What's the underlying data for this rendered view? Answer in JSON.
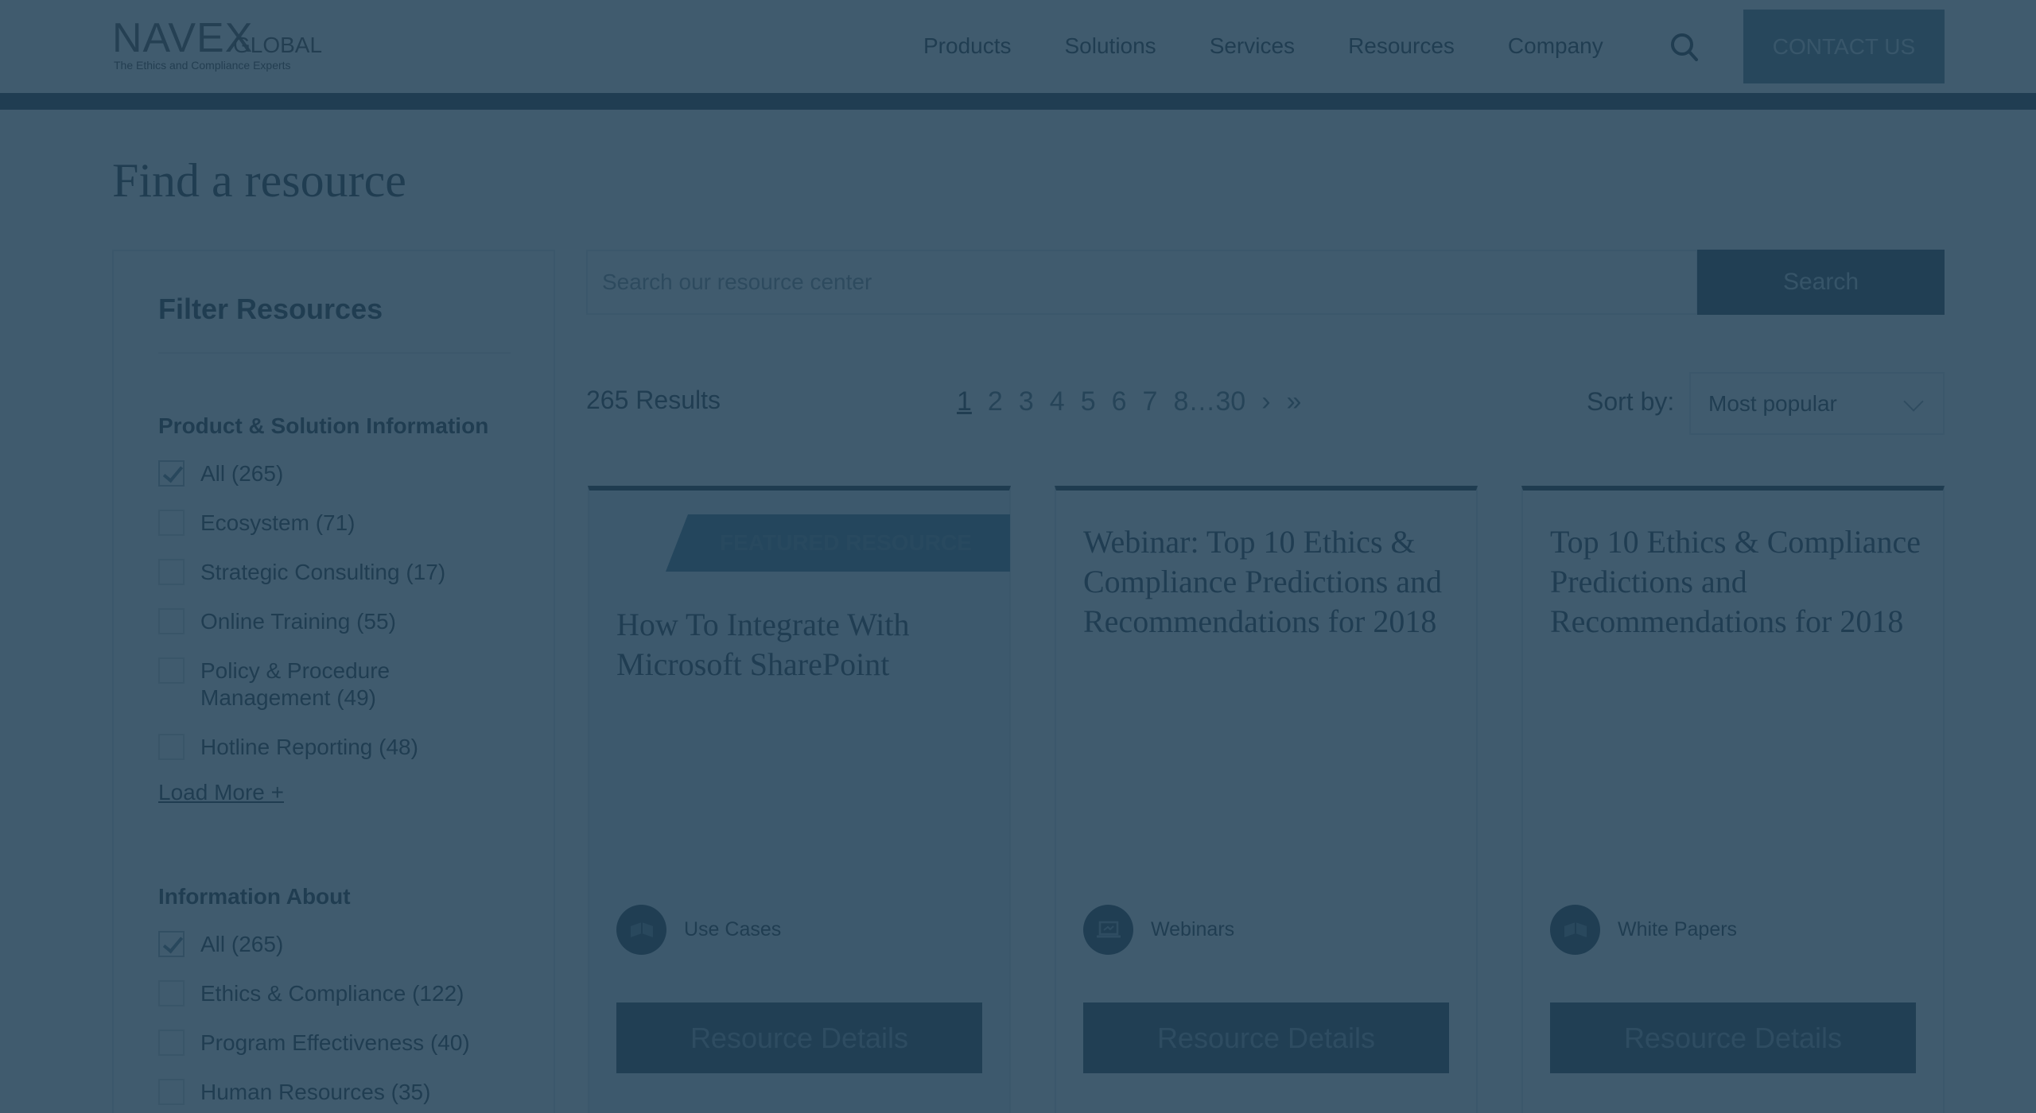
{
  "header": {
    "logo_main": "NAVEX",
    "logo_global": "GLOBAL",
    "logo_tagline": "The Ethics and Compliance Experts",
    "nav": [
      "Products",
      "Solutions",
      "Services",
      "Resources",
      "Company"
    ],
    "contact_label": "CONTACT US"
  },
  "page_title": "Find a resource",
  "filters": {
    "title": "Filter Resources",
    "groups": [
      {
        "title": "Product & Solution Information",
        "items": [
          {
            "label": "All (265)",
            "checked": true
          },
          {
            "label": "Ecosystem (71)",
            "checked": false
          },
          {
            "label": "Strategic Consulting (17)",
            "checked": false
          },
          {
            "label": "Online Training (55)",
            "checked": false
          },
          {
            "label": "Policy & Procedure Management (49)",
            "checked": false
          },
          {
            "label": "Hotline Reporting (48)",
            "checked": false
          }
        ],
        "load_more": "Load More +"
      },
      {
        "title": "Information About",
        "items": [
          {
            "label": "All (265)",
            "checked": true
          },
          {
            "label": "Ethics & Compliance (122)",
            "checked": false
          },
          {
            "label": "Program Effectiveness (40)",
            "checked": false
          },
          {
            "label": "Human Resources (35)",
            "checked": false
          }
        ]
      }
    ]
  },
  "search": {
    "placeholder": "Search our resource center",
    "button_label": "Search"
  },
  "results": {
    "count_label": "265 Results",
    "pages": [
      "1",
      "2",
      "3",
      "4",
      "5",
      "6",
      "7",
      "8…30",
      "›",
      "»"
    ],
    "current_page": "1",
    "sort_label": "Sort by:",
    "sort_value": "Most popular"
  },
  "cards": [
    {
      "featured_label": "FEATURED RESOURCE",
      "title": "How To Integrate With Microsoft SharePoint",
      "type": "Use Cases",
      "button": "Resource Details"
    },
    {
      "title": "Webinar: Top 10 Ethics & Compliance Predictions and Recommendations for 2018",
      "type": "Webinars",
      "button": "Resource Details"
    },
    {
      "title": "Top 10 Ethics & Compliance Predictions and Recommendations for 2018",
      "type": "White Papers",
      "button": "Resource Details"
    }
  ],
  "colors": {
    "overlay": "#2f4a5c",
    "dark_navy": "#24394a",
    "accent_teal": "#4f7080"
  }
}
